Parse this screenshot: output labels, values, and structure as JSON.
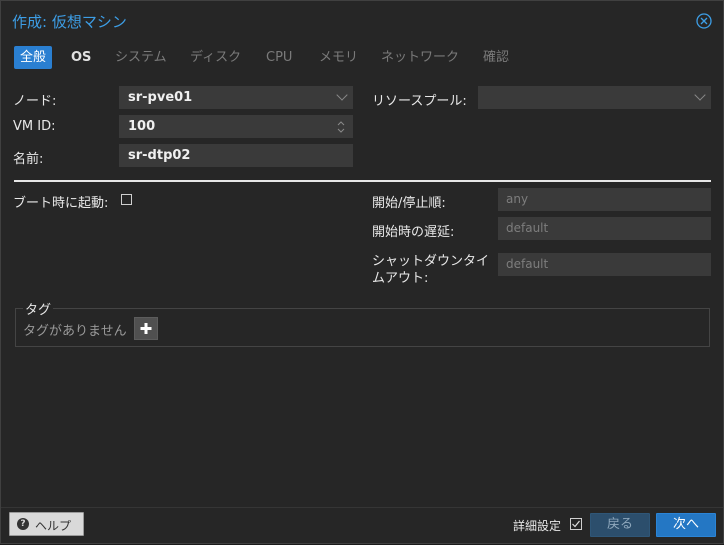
{
  "dialog": {
    "title": "作成: 仮想マシン"
  },
  "tabs": [
    {
      "label": "全般"
    },
    {
      "label": "OS"
    },
    {
      "label": "システム"
    },
    {
      "label": "ディスク"
    },
    {
      "label": "CPU"
    },
    {
      "label": "メモリ"
    },
    {
      "label": "ネットワーク"
    },
    {
      "label": "確認"
    }
  ],
  "form": {
    "node_label": "ノード:",
    "node_value": "sr-pve01",
    "vmid_label": "VM ID:",
    "vmid_value": "100",
    "name_label": "名前:",
    "name_value": "sr-dtp02",
    "pool_label": "リソースプール:",
    "pool_value": "",
    "boot_label": "ブート時に起動:",
    "boot_checked": false,
    "order_label": "開始/停止順:",
    "order_placeholder": "any",
    "startup_delay_label": "開始時の遅延:",
    "startup_delay_placeholder": "default",
    "shutdown_timeout_label_line1": "シャットダウンタイ",
    "shutdown_timeout_label_line2": "ムアウト:",
    "shutdown_timeout_placeholder": "default"
  },
  "tags": {
    "legend": "タグ",
    "empty_text": "タグがありません"
  },
  "footer": {
    "help_label": "ヘルプ",
    "advanced_label": "詳細設定",
    "advanced_checked": true,
    "back_label": "戻る",
    "next_label": "次へ"
  },
  "colors": {
    "accent": "#2a7fd1",
    "title": "#3d9ee6",
    "background": "#262626"
  }
}
